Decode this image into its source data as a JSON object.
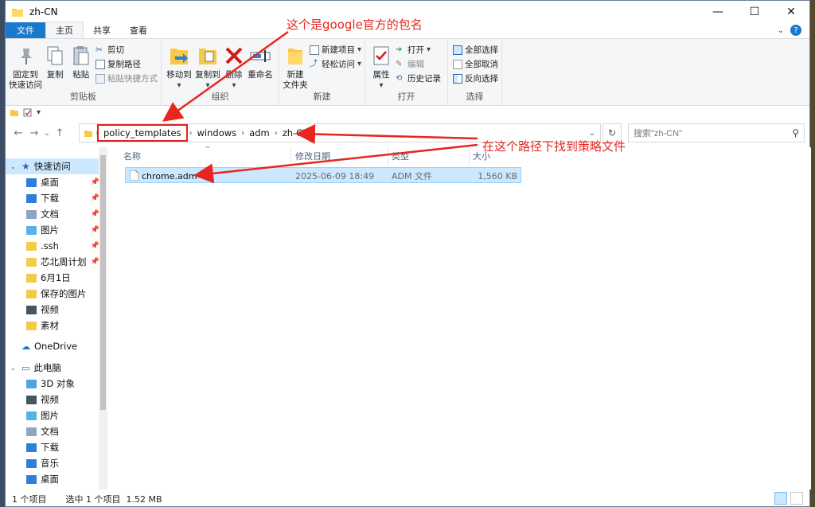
{
  "window": {
    "title": "zh-CN"
  },
  "tabs": [
    {
      "label": "文件"
    },
    {
      "label": "主页"
    },
    {
      "label": "共享"
    },
    {
      "label": "查看"
    }
  ],
  "ribbon": {
    "clipboard": {
      "label": "剪贴板",
      "pin": "固定到\n快速访问",
      "pin_l1": "固定到",
      "pin_l2": "快速访问",
      "copy": "复制",
      "paste": "粘贴",
      "cut": "剪切",
      "copy_path": "复制路径",
      "paste_shortcut": "粘贴快捷方式"
    },
    "organize": {
      "label": "组织",
      "move_to": "移动到",
      "copy_to": "复制到",
      "delete": "删除",
      "rename": "重命名"
    },
    "new": {
      "label": "新建",
      "new_folder_l1": "新建",
      "new_folder_l2": "文件夹",
      "new_item": "新建项目",
      "easy_access": "轻松访问"
    },
    "open": {
      "label": "打开",
      "properties": "属性",
      "open": "打开",
      "edit": "编辑",
      "history": "历史记录"
    },
    "select": {
      "label": "选择",
      "select_all": "全部选择",
      "select_none": "全部取消",
      "invert": "反向选择"
    }
  },
  "address": {
    "crumbs": [
      "policy_templates",
      "windows",
      "adm",
      "zh-CN"
    ],
    "search_placeholder": "搜索\"zh-CN\""
  },
  "nav": {
    "quick_access": "快速访问",
    "items": [
      {
        "label": "桌面",
        "pinned": true
      },
      {
        "label": "下载",
        "pinned": true
      },
      {
        "label": "文档",
        "pinned": true
      },
      {
        "label": "图片",
        "pinned": true
      },
      {
        "label": ".ssh",
        "pinned": true
      },
      {
        "label": "芯北周计划",
        "pinned": true
      },
      {
        "label": "6月1日",
        "pinned": false
      },
      {
        "label": "保存的图片",
        "pinned": false
      },
      {
        "label": "视频",
        "pinned": false
      },
      {
        "label": "素材",
        "pinned": false
      }
    ],
    "onedrive": "OneDrive",
    "this_pc": "此电脑",
    "pc_items": [
      {
        "label": "3D 对象"
      },
      {
        "label": "视频"
      },
      {
        "label": "图片"
      },
      {
        "label": "文档"
      },
      {
        "label": "下载"
      },
      {
        "label": "音乐"
      },
      {
        "label": "桌面"
      }
    ]
  },
  "columns": {
    "name": "名称",
    "modified": "修改日期",
    "type": "类型",
    "size": "大小"
  },
  "files": [
    {
      "name": "chrome.adm",
      "modified": "2025-06-09 18:49",
      "type": "ADM 文件",
      "size": "1,560 KB"
    }
  ],
  "status": {
    "count": "1 个项目",
    "selected": "选中 1 个项目  1.52 MB"
  },
  "annotations": {
    "top": "这个是google官方的包名",
    "right": "在这个路径下找到策略文件"
  },
  "colors": {
    "accent": "#1979ca",
    "selection": "#cce8ff",
    "annotation": "#e8261f"
  }
}
